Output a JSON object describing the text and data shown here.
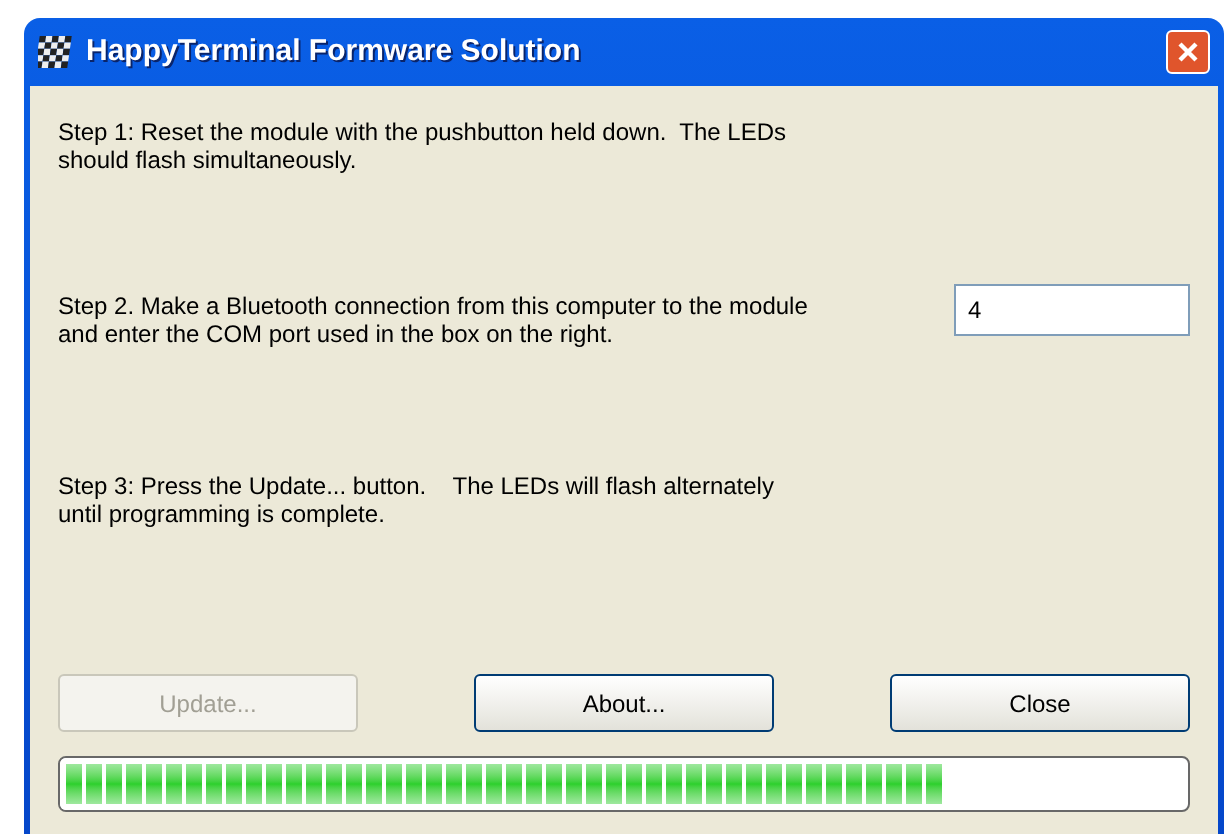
{
  "window": {
    "title": "HappyTerminal Formware Solution"
  },
  "steps": [
    {
      "text": "Step 1: Reset the module with the pushbutton held down.  The LEDs\nshould flash simultaneously."
    },
    {
      "text": "Step 2. Make a Bluetooth connection from this computer to the module\nand enter the COM port used in the box on the right."
    },
    {
      "text": "Step 3: Press the Update... button.    The LEDs will flash alternately\nuntil programming is complete."
    }
  ],
  "com_port": {
    "value": "4"
  },
  "buttons": [
    {
      "label": "Update...",
      "disabled": true
    },
    {
      "label": "About...",
      "disabled": false
    },
    {
      "label": "Close",
      "disabled": false
    }
  ],
  "progress": {
    "level": 0.79
  }
}
